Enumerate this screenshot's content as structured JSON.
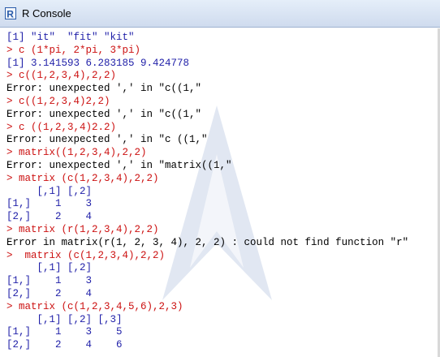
{
  "window": {
    "title": "R Console",
    "icon": "r-logo-icon"
  },
  "colors": {
    "output": "#1f1fa8",
    "input": "#cc1111",
    "error": "#000000"
  },
  "console": {
    "lines": [
      {
        "type": "out",
        "text": "[1] \"it\"  \"fit\" \"kit\""
      },
      {
        "type": "in",
        "text": "> c (1*pi, 2*pi, 3*pi)"
      },
      {
        "type": "out",
        "text": "[1] 3.141593 6.283185 9.424778"
      },
      {
        "type": "in",
        "text": "> c((1,2,3,4),2,2)"
      },
      {
        "type": "err",
        "text": "Error: unexpected ',' in \"c((1,\""
      },
      {
        "type": "in",
        "text": "> c((1,2,3,4)2,2)"
      },
      {
        "type": "err",
        "text": "Error: unexpected ',' in \"c((1,\""
      },
      {
        "type": "in",
        "text": "> c ((1,2,3,4)2.2)"
      },
      {
        "type": "err",
        "text": "Error: unexpected ',' in \"c ((1,\""
      },
      {
        "type": "in",
        "text": "> matrix((1,2,3,4),2,2)"
      },
      {
        "type": "err",
        "text": "Error: unexpected ',' in \"matrix((1,\""
      },
      {
        "type": "in",
        "text": "> matrix (c(1,2,3,4),2,2)"
      },
      {
        "type": "out",
        "text": "     [,1] [,2]"
      },
      {
        "type": "out",
        "text": "[1,]    1    3"
      },
      {
        "type": "out",
        "text": "[2,]    2    4"
      },
      {
        "type": "in",
        "text": "> matrix (r(1,2,3,4),2,2)"
      },
      {
        "type": "err",
        "text": "Error in matrix(r(1, 2, 3, 4), 2, 2) : could not find function \"r\""
      },
      {
        "type": "in",
        "text": ">  matrix (c(1,2,3,4),2,2)"
      },
      {
        "type": "out",
        "text": "     [,1] [,2]"
      },
      {
        "type": "out",
        "text": "[1,]    1    3"
      },
      {
        "type": "out",
        "text": "[2,]    2    4"
      },
      {
        "type": "in",
        "text": "> matrix (c(1,2,3,4,5,6),2,3)"
      },
      {
        "type": "out",
        "text": "     [,1] [,2] [,3]"
      },
      {
        "type": "out",
        "text": "[1,]    1    3    5"
      },
      {
        "type": "out",
        "text": "[2,]    2    4    6"
      }
    ]
  }
}
